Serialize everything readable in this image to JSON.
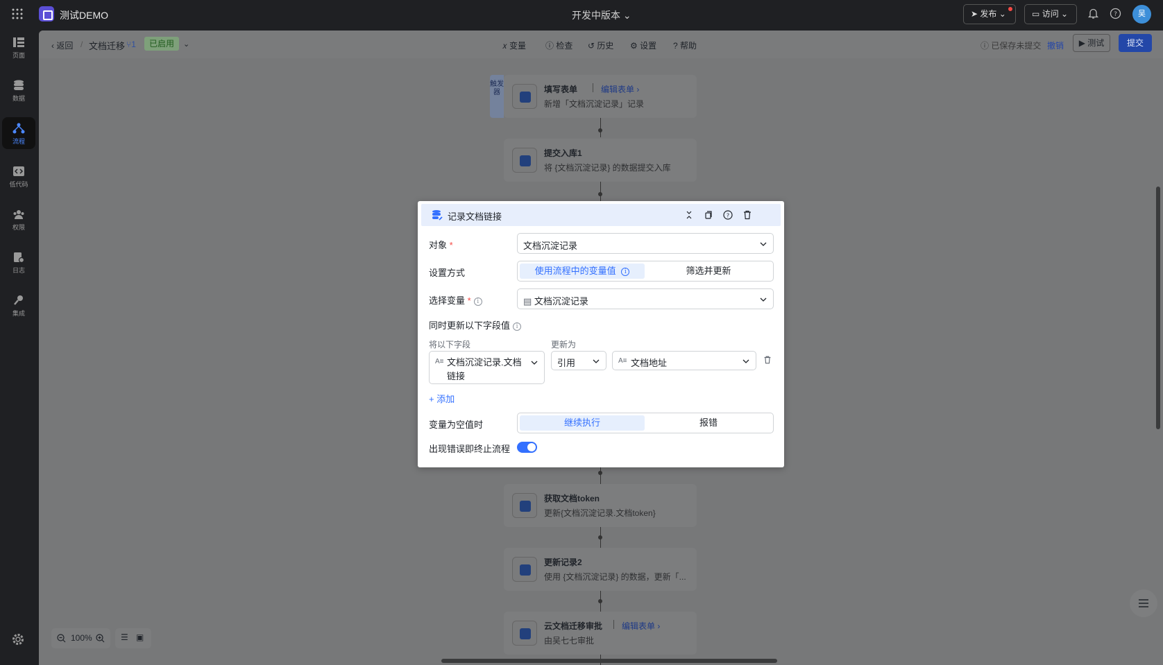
{
  "topbar": {
    "app_name": "测试DEMO",
    "version": "开发中版本",
    "publish": "发布",
    "visit": "访问",
    "avatar": "吴"
  },
  "sidebar": {
    "items": [
      {
        "label": "页面",
        "icon": "pages-icon"
      },
      {
        "label": "数据",
        "icon": "database-icon"
      },
      {
        "label": "流程",
        "icon": "flow-icon"
      },
      {
        "label": "低代码",
        "icon": "code-icon"
      },
      {
        "label": "权限",
        "icon": "users-icon"
      },
      {
        "label": "日志",
        "icon": "log-icon"
      },
      {
        "label": "集成",
        "icon": "key-icon"
      }
    ],
    "active": "流程"
  },
  "subbar": {
    "back": "返回",
    "sep": "/",
    "flow_name": "文档迁移",
    "flow_version": "1",
    "status": "已启用",
    "tools": [
      "变量",
      "检查",
      "历史",
      "设置",
      "帮助"
    ],
    "saved_notice": "已保存未提交",
    "undo": "撤销",
    "test": "测试",
    "submit": "提交"
  },
  "trigger_tag": "触发器",
  "nodes": [
    {
      "title": "填写表单",
      "sub": "新增「文档沉淀记录」记录",
      "link": "编辑表单"
    },
    {
      "title": "提交入库1",
      "sub": "将 {文档沉淀记录} 的数据提交入库"
    },
    {
      "title": "获取文档token",
      "sub": "更新{文档沉淀记录.文档token}"
    },
    {
      "title": "更新记录2",
      "sub": "使用 {文档沉淀记录} 的数据，更新「..."
    },
    {
      "title": "云文档迁移审批",
      "sub": "由吴七七审批",
      "link": "编辑表单"
    }
  ],
  "zoom": "100%",
  "modal": {
    "title": "记录文档链接",
    "object_label": "对象",
    "object_value": "文档沉淀记录",
    "mode_label": "设置方式",
    "mode_options": [
      "使用流程中的变量值",
      "筛选并更新"
    ],
    "mode_selected": 0,
    "variable_label": "选择变量",
    "variable_value": "文档沉淀记录",
    "update_fields_label": "同时更新以下字段值",
    "col_field": "将以下字段",
    "col_update_to": "更新为",
    "field_value": "文档沉淀记录.文档链接",
    "ref_value": "引用",
    "target_value": "文档地址",
    "add": "添加",
    "empty_label": "变量为空值时",
    "empty_options": [
      "继续执行",
      "报错"
    ],
    "empty_selected": 0,
    "stop_label": "出现错误即终止流程",
    "stop_on_error": true
  }
}
